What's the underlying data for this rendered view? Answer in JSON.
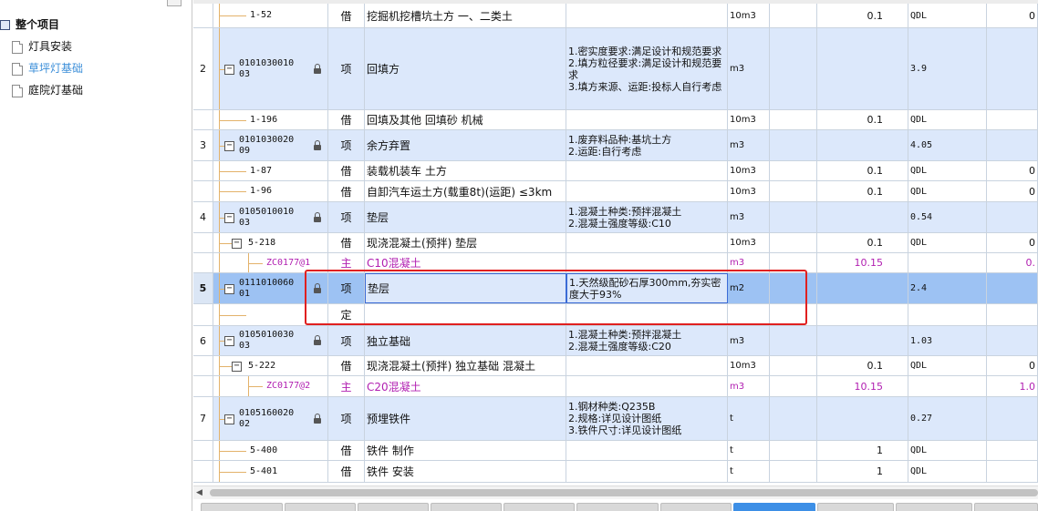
{
  "tree": {
    "root": "整个项目",
    "children": [
      "灯具安装",
      "草坪灯基础",
      "庭院灯基础"
    ],
    "selected_index": 1
  },
  "grid": {
    "rows": [
      {
        "seq": "",
        "code": "1-52",
        "cat": "借",
        "name": "挖掘机挖槽坑土方 一、二类土",
        "desc": [],
        "unit": "10m3",
        "coef": "0.1",
        "qty": "QDL",
        "last": "0"
      },
      {
        "seq": "2",
        "code": "010103001003",
        "cat": "项",
        "name": "回填方",
        "desc": [
          "1.密实度要求:满足设计和规范要求",
          "2.填方粒径要求:满足设计和规范要求",
          "3.填方来源、运距:投标人自行考虑"
        ],
        "unit": "m3",
        "coef": "",
        "qty": "3.9",
        "last": ""
      },
      {
        "seq": "",
        "code": "1-196",
        "cat": "借",
        "name": "回填及其他 回填砂 机械",
        "desc": [],
        "unit": "10m3",
        "coef": "0.1",
        "qty": "QDL",
        "last": ""
      },
      {
        "seq": "3",
        "code": "010103002009",
        "cat": "项",
        "name": "余方弃置",
        "desc": [
          "1.废弃料品种:基坑土方",
          "2.运距:自行考虑"
        ],
        "unit": "m3",
        "coef": "",
        "qty": "4.05",
        "last": ""
      },
      {
        "seq": "",
        "code": "1-87",
        "cat": "借",
        "name": "装载机装车 土方",
        "desc": [],
        "unit": "10m3",
        "coef": "0.1",
        "qty": "QDL",
        "last": "0"
      },
      {
        "seq": "",
        "code": "1-96",
        "cat": "借",
        "name": "自卸汽车运土方(载重8t)(运距) ≤3km",
        "desc": [],
        "unit": "10m3",
        "coef": "0.1",
        "qty": "QDL",
        "last": "0"
      },
      {
        "seq": "4",
        "code": "010501001003",
        "cat": "项",
        "name": "垫层",
        "desc": [
          "1.混凝土种类:预拌混凝土",
          "2.混凝土强度等级:C10"
        ],
        "unit": "m3",
        "coef": "",
        "qty": "0.54",
        "last": ""
      },
      {
        "seq": "",
        "code": "5-218",
        "cat": "借",
        "name": "现浇混凝土(预拌) 垫层",
        "desc": [],
        "unit": "10m3",
        "coef": "0.1",
        "qty": "QDL",
        "last": "0"
      },
      {
        "seq": "",
        "code": "ZC0177@1",
        "cat": "主",
        "name": "C10混凝土",
        "desc": [],
        "unit": "m3",
        "coef": "10.15",
        "qty": "",
        "last": "0."
      },
      {
        "seq": "5",
        "code": "011101006001",
        "cat": "项",
        "name": "垫层",
        "desc": [
          "1.天然级配砂石厚300mm,夯实密度大于93%"
        ],
        "unit": "m2",
        "coef": "",
        "qty": "2.4",
        "last": ""
      },
      {
        "seq": "",
        "code": "",
        "cat": "定",
        "name": "",
        "desc": [],
        "unit": "",
        "coef": "",
        "qty": "",
        "last": ""
      },
      {
        "seq": "6",
        "code": "010501003003",
        "cat": "项",
        "name": "独立基础",
        "desc": [
          "1.混凝土种类:预拌混凝土",
          "2.混凝土强度等级:C20"
        ],
        "unit": "m3",
        "coef": "",
        "qty": "1.03",
        "last": ""
      },
      {
        "seq": "",
        "code": "5-222",
        "cat": "借",
        "name": "现浇混凝土(预拌) 独立基础 混凝土",
        "desc": [],
        "unit": "10m3",
        "coef": "0.1",
        "qty": "QDL",
        "last": "0"
      },
      {
        "seq": "",
        "code": "ZC0177@2",
        "cat": "主",
        "name": "C20混凝土",
        "desc": [],
        "unit": "m3",
        "coef": "10.15",
        "qty": "",
        "last": "1.0"
      },
      {
        "seq": "7",
        "code": "010516002002",
        "cat": "项",
        "name": "预埋铁件",
        "desc": [
          "1.钢材种类:Q235B",
          "2.规格:详见设计图纸",
          "3.铁件尺寸:详见设计图纸"
        ],
        "unit": "t",
        "coef": "",
        "qty": "0.27",
        "last": ""
      },
      {
        "seq": "",
        "code": "5-400",
        "cat": "借",
        "name": "铁件 制作",
        "desc": [],
        "unit": "t",
        "coef": "1",
        "qty": "QDL",
        "last": ""
      },
      {
        "seq": "",
        "code": "5-401",
        "cat": "借",
        "name": "铁件 安装",
        "desc": [],
        "unit": "t",
        "coef": "1",
        "qty": "QDL",
        "last": ""
      }
    ],
    "selected_row": 9
  },
  "colors": {
    "accent": "#3d8fe6",
    "highlight_box": "#e02020",
    "item_row": "#dce8fb",
    "material_text": "#b11fb1"
  }
}
